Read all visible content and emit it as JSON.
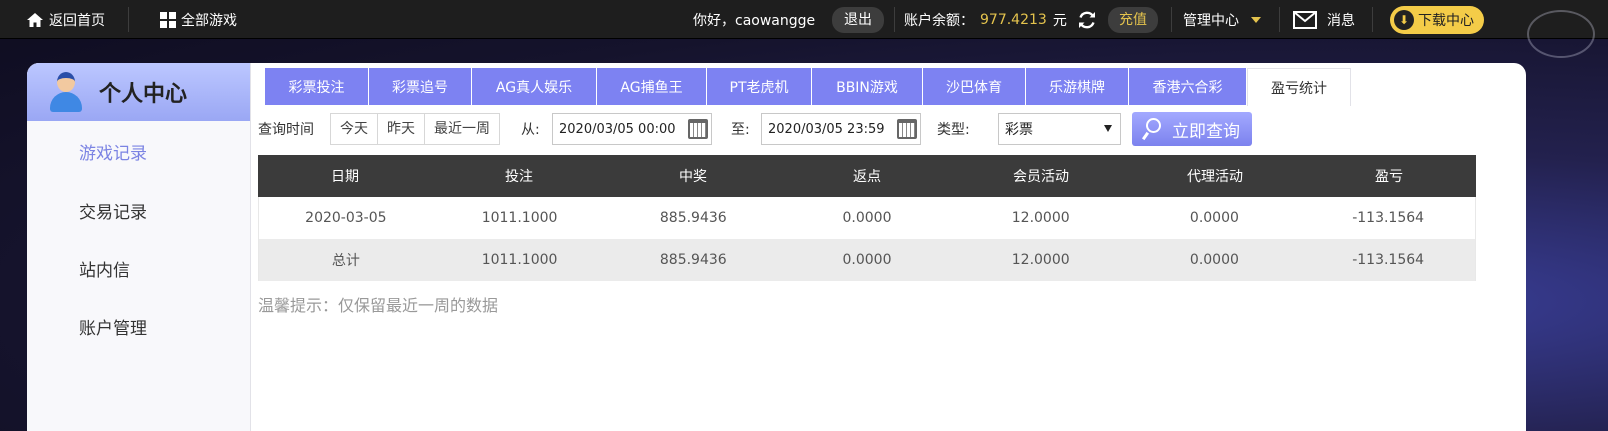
{
  "topbar": {
    "home_label": "返回首页",
    "all_games_label": "全部游戏",
    "greeting": "你好，caowangge",
    "logout_label": "退出",
    "balance_label": "账户余额：",
    "balance_value": "977.4213",
    "balance_unit": "元",
    "recharge_label": "充值",
    "manage_label": "管理中心",
    "message_label": "消息",
    "download_label": "下载中心"
  },
  "sidebar": {
    "title": "个人中心",
    "items": [
      {
        "label": "游戏记录",
        "active": true
      },
      {
        "label": "交易记录",
        "active": false
      },
      {
        "label": "站内信",
        "active": false
      },
      {
        "label": "账户管理",
        "active": false
      }
    ]
  },
  "tabs": [
    {
      "label": "彩票投注"
    },
    {
      "label": "彩票追号"
    },
    {
      "label": "AG真人娱乐"
    },
    {
      "label": "AG捕鱼王"
    },
    {
      "label": "PT老虎机"
    },
    {
      "label": "BBIN游戏"
    },
    {
      "label": "沙巴体育"
    },
    {
      "label": "乐游棋牌"
    },
    {
      "label": "香港六合彩"
    },
    {
      "label": "盈亏统计",
      "active": true
    }
  ],
  "filter": {
    "time_label": "查询时间",
    "quick": [
      "今天",
      "昨天",
      "最近一周"
    ],
    "from_label": "从:",
    "from_value": "2020/03/05 00:00",
    "to_label": "至:",
    "to_value": "2020/03/05 23:59",
    "type_label": "类型:",
    "type_value": "彩票",
    "query_label": "立即查询"
  },
  "table": {
    "headers": [
      "日期",
      "投注",
      "中奖",
      "返点",
      "会员活动",
      "代理活动",
      "盈亏"
    ],
    "rows": [
      [
        "2020-03-05",
        "1011.1000",
        "885.9436",
        "0.0000",
        "12.0000",
        "0.0000",
        "-113.1564"
      ],
      [
        "总计",
        "1011.1000",
        "885.9436",
        "0.0000",
        "12.0000",
        "0.0000",
        "-113.1564"
      ]
    ]
  },
  "tip": "温馨提示：仅保留最近一周的数据",
  "colors": {
    "accent": "#7d82f2",
    "balance": "#e4c34d",
    "download_button": "#f4cc48",
    "table_header": "#3b3b3b"
  }
}
